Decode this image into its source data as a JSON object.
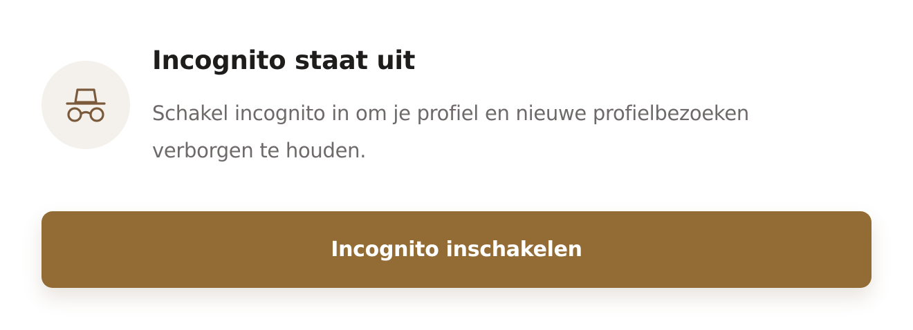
{
  "incognito": {
    "icon": "incognito-icon",
    "title": "Incognito staat uit",
    "description": "Schakel incognito in om je profiel en nieuwe profielbezoeken verborgen te houden.",
    "button_label": "Incognito inschakelen"
  },
  "colors": {
    "button_bg": "#936b34",
    "button_text": "#ffffff",
    "icon_stroke": "#7b5a3c",
    "icon_circle_bg": "#f4f1ed",
    "title": "#1f1d1c",
    "description": "#6f6a6a"
  }
}
